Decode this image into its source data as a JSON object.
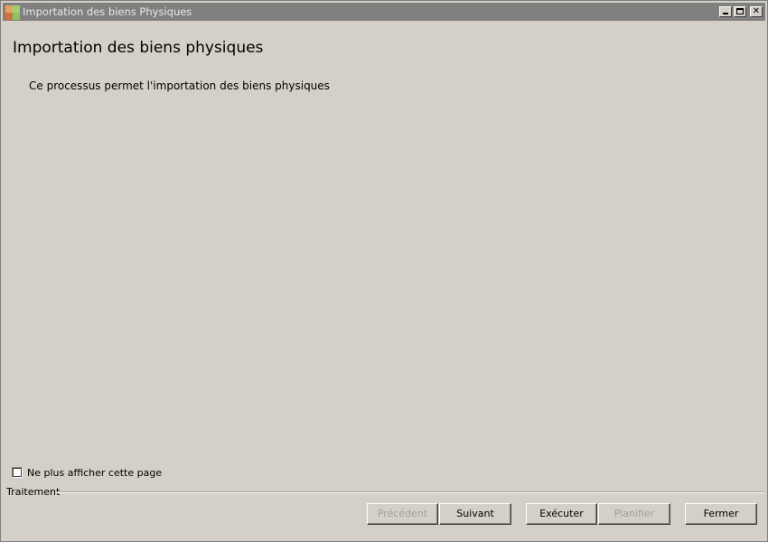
{
  "window": {
    "title": "Importation des biens Physiques"
  },
  "main": {
    "heading": "Importation des biens physiques",
    "description": "Ce processus permet l'importation des biens physiques"
  },
  "footer": {
    "dont_show_label": "Ne plus afficher cette page",
    "dont_show_checked": false,
    "group_label": "Traitement",
    "buttons": {
      "previous": "Précédent",
      "next": "Suivant",
      "execute": "Exécuter",
      "schedule": "Planifier",
      "close": "Fermer"
    }
  },
  "colors": {
    "background": "#d4d0c8",
    "titlebar": "#808080",
    "disabled_text": "#a0a0a0"
  }
}
